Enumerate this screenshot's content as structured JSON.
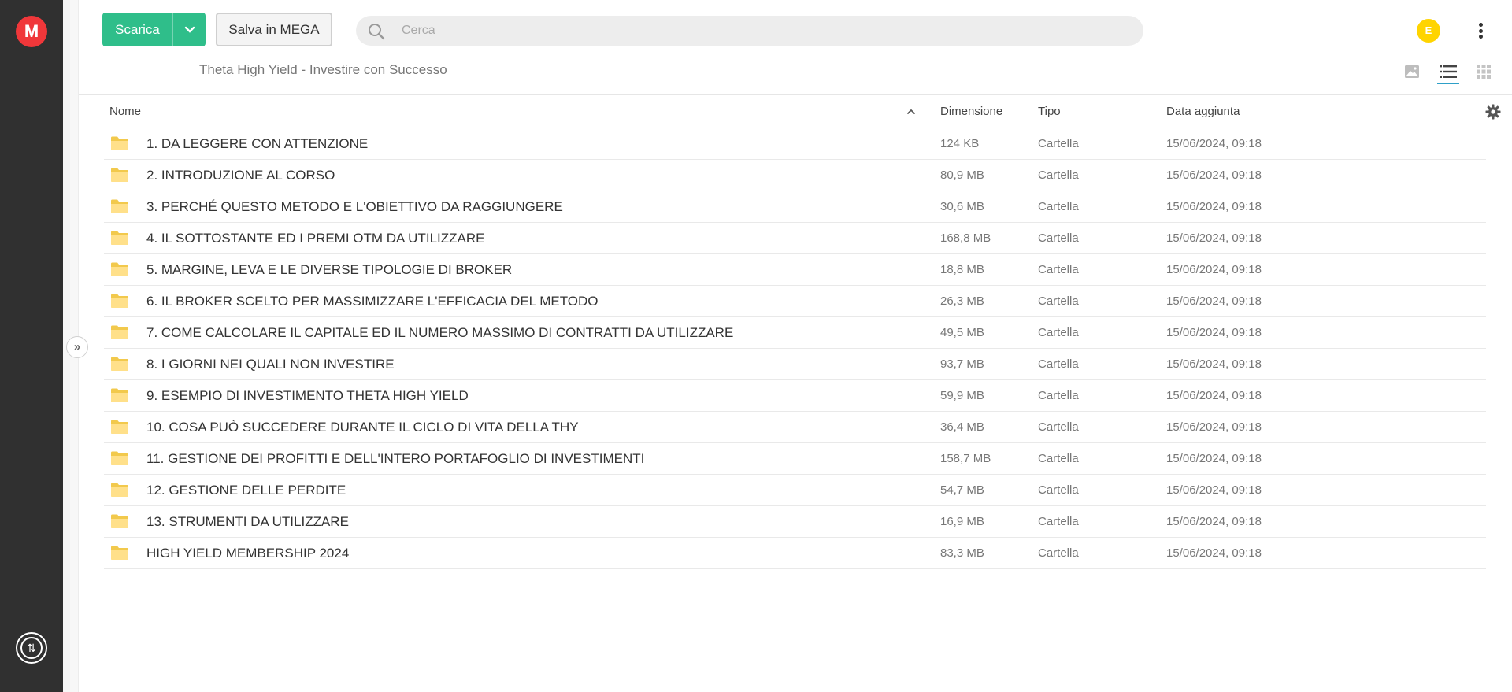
{
  "brand": {
    "logo_letter": "M",
    "color": "#f0373a"
  },
  "toolbar": {
    "download_label": "Scarica",
    "save_label": "Salva in MEGA",
    "accent": "#2fbe8a"
  },
  "search": {
    "placeholder": "Cerca",
    "value": ""
  },
  "user": {
    "avatar_letter": "E",
    "avatar_color": "#ffd400"
  },
  "breadcrumb": "Theta High Yield - Investire con Successo",
  "view_modes": [
    "media-view",
    "list-view",
    "grid-view"
  ],
  "active_view": "list-view",
  "table": {
    "columns": {
      "name": "Nome",
      "size": "Dimensione",
      "type": "Tipo",
      "date": "Data aggiunta"
    },
    "sort": "name-ascending",
    "rows": [
      {
        "name": "1. DA LEGGERE CON ATTENZIONE",
        "size": "124 KB",
        "type": "Cartella",
        "date": "15/06/2024, 09:18"
      },
      {
        "name": "2. INTRODUZIONE AL CORSO",
        "size": "80,9 MB",
        "type": "Cartella",
        "date": "15/06/2024, 09:18"
      },
      {
        "name": "3. PERCHÉ QUESTO METODO E L'OBIETTIVO DA RAGGIUNGERE",
        "size": "30,6 MB",
        "type": "Cartella",
        "date": "15/06/2024, 09:18"
      },
      {
        "name": "4. IL SOTTOSTANTE ED I PREMI OTM DA UTILIZZARE",
        "size": "168,8 MB",
        "type": "Cartella",
        "date": "15/06/2024, 09:18"
      },
      {
        "name": "5. MARGINE, LEVA E LE DIVERSE TIPOLOGIE DI BROKER",
        "size": "18,8 MB",
        "type": "Cartella",
        "date": "15/06/2024, 09:18"
      },
      {
        "name": "6. IL BROKER SCELTO PER MASSIMIZZARE L'EFFICACIA DEL METODO",
        "size": "26,3 MB",
        "type": "Cartella",
        "date": "15/06/2024, 09:18"
      },
      {
        "name": "7. COME CALCOLARE IL CAPITALE ED IL NUMERO MASSIMO DI CONTRATTI DA UTILIZZARE",
        "size": "49,5 MB",
        "type": "Cartella",
        "date": "15/06/2024, 09:18"
      },
      {
        "name": "8. I GIORNI NEI QUALI NON INVESTIRE",
        "size": "93,7 MB",
        "type": "Cartella",
        "date": "15/06/2024, 09:18"
      },
      {
        "name": "9. ESEMPIO DI INVESTIMENTO THETA HIGH YIELD",
        "size": "59,9 MB",
        "type": "Cartella",
        "date": "15/06/2024, 09:18"
      },
      {
        "name": "10. COSA PUÒ SUCCEDERE DURANTE IL CICLO DI VITA DELLA THY",
        "size": "36,4 MB",
        "type": "Cartella",
        "date": "15/06/2024, 09:18"
      },
      {
        "name": "11. GESTIONE DEI PROFITTI E DELL'INTERO PORTAFOGLIO DI INVESTIMENTI",
        "size": "158,7 MB",
        "type": "Cartella",
        "date": "15/06/2024, 09:18"
      },
      {
        "name": "12. GESTIONE DELLE PERDITE",
        "size": "54,7 MB",
        "type": "Cartella",
        "date": "15/06/2024, 09:18"
      },
      {
        "name": "13. STRUMENTI DA UTILIZZARE",
        "size": "16,9 MB",
        "type": "Cartella",
        "date": "15/06/2024, 09:18"
      },
      {
        "name": "HIGH YIELD MEMBERSHIP 2024",
        "size": "83,3 MB",
        "type": "Cartella",
        "date": "15/06/2024, 09:18"
      }
    ]
  },
  "icons": {
    "folder": "folder-icon",
    "search": "search-icon",
    "settings": "gear-icon",
    "transfers": "transfers-icon"
  }
}
